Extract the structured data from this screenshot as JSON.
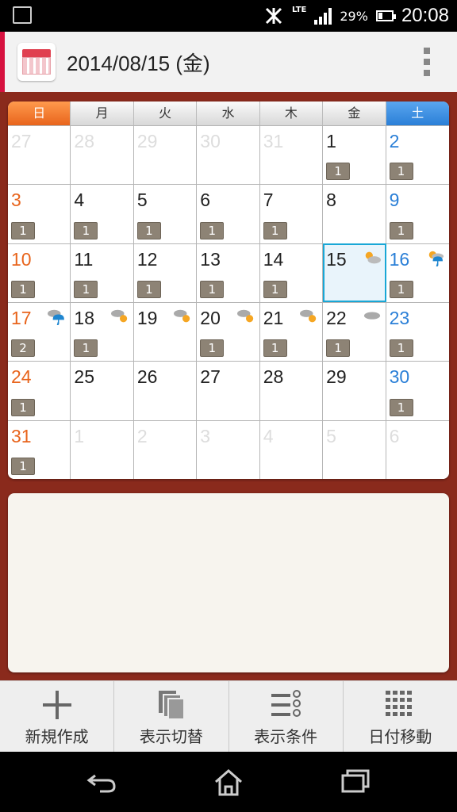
{
  "status": {
    "battery": "29%",
    "time": "20:08",
    "network": "LTE"
  },
  "header": {
    "title": "2014/08/15 (金)"
  },
  "calendar": {
    "weekdays": [
      "日",
      "月",
      "火",
      "水",
      "木",
      "金",
      "土"
    ],
    "days": [
      {
        "d": "27",
        "m": true
      },
      {
        "d": "28",
        "m": true
      },
      {
        "d": "29",
        "m": true
      },
      {
        "d": "30",
        "m": true
      },
      {
        "d": "31",
        "m": true
      },
      {
        "d": "1",
        "b": "1"
      },
      {
        "d": "2",
        "b": "1"
      },
      {
        "d": "3",
        "b": "1"
      },
      {
        "d": "4",
        "b": "1"
      },
      {
        "d": "5",
        "b": "1"
      },
      {
        "d": "6",
        "b": "1"
      },
      {
        "d": "7",
        "b": "1"
      },
      {
        "d": "8"
      },
      {
        "d": "9",
        "b": "1"
      },
      {
        "d": "10",
        "b": "1"
      },
      {
        "d": "11",
        "b": "1"
      },
      {
        "d": "12",
        "b": "1"
      },
      {
        "d": "13",
        "b": "1"
      },
      {
        "d": "14",
        "b": "1"
      },
      {
        "d": "15",
        "t": true,
        "w": "sun-cloud"
      },
      {
        "d": "16",
        "b": "1",
        "w": "sun-rain"
      },
      {
        "d": "17",
        "b": "2",
        "w": "cloud-rain"
      },
      {
        "d": "18",
        "b": "1",
        "w": "cloud-sun"
      },
      {
        "d": "19",
        "w": "cloud-sun"
      },
      {
        "d": "20",
        "b": "1",
        "w": "cloud-sun"
      },
      {
        "d": "21",
        "b": "1",
        "w": "cloud-sun"
      },
      {
        "d": "22",
        "b": "1",
        "w": "cloud"
      },
      {
        "d": "23",
        "b": "1"
      },
      {
        "d": "24",
        "b": "1"
      },
      {
        "d": "25"
      },
      {
        "d": "26"
      },
      {
        "d": "27"
      },
      {
        "d": "28"
      },
      {
        "d": "29"
      },
      {
        "d": "30",
        "b": "1"
      },
      {
        "d": "31",
        "b": "1"
      },
      {
        "d": "1",
        "m": true
      },
      {
        "d": "2",
        "m": true
      },
      {
        "d": "3",
        "m": true
      },
      {
        "d": "4",
        "m": true
      },
      {
        "d": "5",
        "m": true
      },
      {
        "d": "6",
        "m": true
      }
    ]
  },
  "toolbar": {
    "new_label": "新規作成",
    "switch_label": "表示切替",
    "filter_label": "表示条件",
    "jump_label": "日付移動"
  },
  "colors": {
    "accent": "#d6113f",
    "sunday": "#e8641c",
    "saturday": "#2a7fd7",
    "today": "#19a7d6",
    "background": "#8a2a1c"
  }
}
